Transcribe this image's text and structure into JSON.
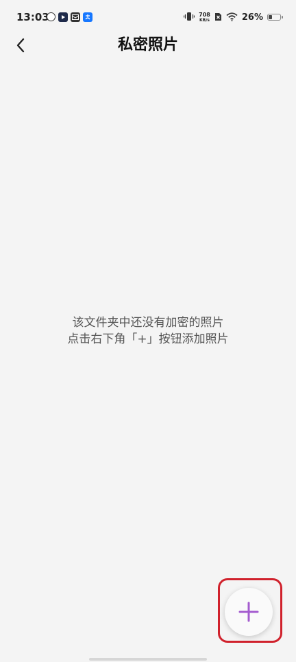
{
  "status_bar": {
    "time": "13:03",
    "net_speed_value": "708",
    "net_speed_unit": "KB/s",
    "battery_percent_text": "26%",
    "battery_level": 0.26
  },
  "header": {
    "title": "私密照片",
    "back_icon": "chevron-left-icon"
  },
  "empty_state": {
    "line1": "该文件夹中还没有加密的照片",
    "line2": "点击右下角「+」按钮添加照片"
  },
  "fab": {
    "icon": "plus-icon",
    "accent_color": "#a45ccf"
  },
  "highlight_color": "#d0212c"
}
